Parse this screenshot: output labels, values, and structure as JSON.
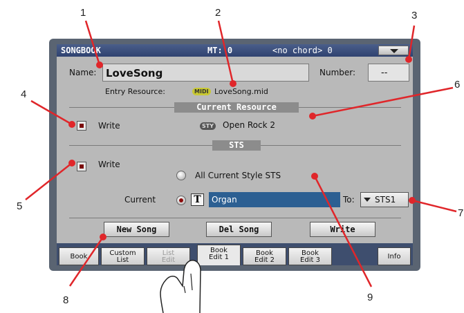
{
  "callouts": [
    "1",
    "2",
    "3",
    "4",
    "5",
    "6",
    "7",
    "8",
    "9"
  ],
  "titlebar": {
    "app": "SONGBOOK",
    "mt": "MT: 0",
    "chord": "<no chord> 0"
  },
  "name": {
    "label": "Name:",
    "value": "LoveSong"
  },
  "number": {
    "label": "Number:",
    "value": "--"
  },
  "entry": {
    "label": "Entry Resource:",
    "tag": "MIDI",
    "file": "LoveSong.mid"
  },
  "current_resource": {
    "title": "Current Resource",
    "write_label": "Write",
    "tag": "STY",
    "style": "Open Rock 2"
  },
  "sts": {
    "title": "STS",
    "write_label": "Write",
    "all_label": "All Current Style STS",
    "current_label": "Current",
    "t_label": "T",
    "sound": "Organ",
    "to_label": "To:",
    "to_value": "STS1"
  },
  "buttons": {
    "new_song": "New Song",
    "del_song": "Del Song",
    "write": "Write"
  },
  "tabs": [
    {
      "l1": "Book",
      "l2": ""
    },
    {
      "l1": "Custom",
      "l2": "List"
    },
    {
      "l1": "List",
      "l2": "Edit"
    },
    {
      "l1": "Book",
      "l2": "Edit 1"
    },
    {
      "l1": "Book",
      "l2": "Edit 2"
    },
    {
      "l1": "Book",
      "l2": "Edit 3"
    },
    {
      "l1": "Info",
      "l2": ""
    }
  ],
  "colors": {
    "callout_red": "#e0262a",
    "title_bar": "#3b4f7e",
    "sound_field": "#2c5f92",
    "midi_tag": "#c8c832",
    "sty_tag": "#555555"
  }
}
